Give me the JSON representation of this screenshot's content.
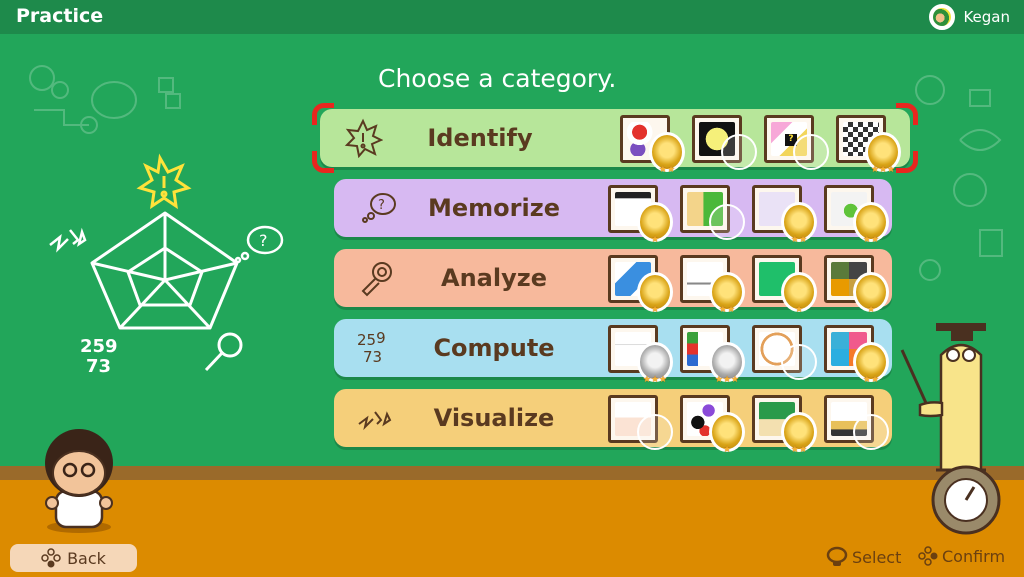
{
  "header": {
    "title": "Practice",
    "user_name": "Kegan"
  },
  "prompt": "Choose a category.",
  "colors": {
    "identify": "#b7e69a",
    "memorize": "#d7b9f2",
    "analyze": "#f7b99c",
    "compute": "#a8dff0",
    "visualize": "#f5cf7a",
    "selection": "#e8261f"
  },
  "categories": [
    {
      "key": "identify",
      "label": "Identify",
      "icon": "starburst-exclaim-icon",
      "selected": true,
      "games": [
        {
          "art": "apple-bowl",
          "medal": "gold",
          "stars": 2
        },
        {
          "art": "fruit-blur",
          "medal": "none",
          "stars": 0
        },
        {
          "art": "question-block-stars",
          "medal": "none",
          "stars": 0
        },
        {
          "art": "pixel-photo",
          "medal": "gold",
          "stars": 3
        }
      ]
    },
    {
      "key": "memorize",
      "label": "Memorize",
      "icon": "thought-bubble-question-icon",
      "selected": false,
      "games": [
        {
          "art": "number-grid",
          "medal": "gold",
          "stars": 1
        },
        {
          "art": "card-flip",
          "medal": "none",
          "stars": 0
        },
        {
          "art": "animal-lineup",
          "medal": "gold",
          "stars": 2
        },
        {
          "art": "bird-cage",
          "medal": "gold",
          "stars": 2
        }
      ]
    },
    {
      "key": "analyze",
      "label": "Analyze",
      "icon": "magnifying-glass-icon",
      "selected": false,
      "games": [
        {
          "art": "block-stack",
          "medal": "gold",
          "stars": 1
        },
        {
          "art": "balance-scale",
          "medal": "gold",
          "stars": 2
        },
        {
          "art": "green-puzzle",
          "medal": "gold",
          "stars": 1
        },
        {
          "art": "photo-quad",
          "medal": "gold",
          "stars": 1
        }
      ]
    },
    {
      "key": "compute",
      "label": "Compute",
      "icon": "numbers-icon",
      "selected": false,
      "games": [
        {
          "art": "count-grid",
          "medal": "silver",
          "stars": 3
        },
        {
          "art": "number-stack",
          "medal": "silver",
          "stars": 3
        },
        {
          "art": "clock-face",
          "medal": "none",
          "stars": 0
        },
        {
          "art": "balloons",
          "medal": "gold",
          "stars": 2
        }
      ]
    },
    {
      "key": "visualize",
      "label": "Visualize",
      "icon": "lightning-shards-icon",
      "selected": false,
      "games": [
        {
          "art": "boat-silhouette",
          "medal": "none",
          "stars": 0
        },
        {
          "art": "fruit-character",
          "medal": "gold",
          "stars": 1
        },
        {
          "art": "path-blocks",
          "medal": "gold",
          "stars": 2
        },
        {
          "art": "robot-rotate",
          "medal": "none",
          "stars": 0
        }
      ]
    }
  ],
  "radar_chart": {
    "axes": [
      "Identify",
      "Memorize",
      "Analyze",
      "Compute",
      "Visualize"
    ],
    "highlighted_axis": "Identify",
    "compute_digits": "25 9 73"
  },
  "footer": {
    "back_label": "Back",
    "select_label": "Select",
    "confirm_label": "Confirm"
  }
}
